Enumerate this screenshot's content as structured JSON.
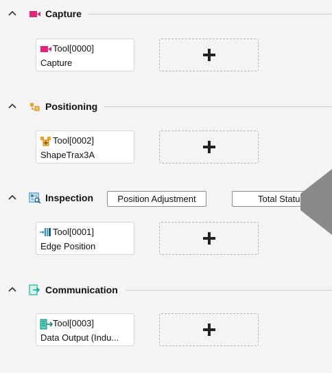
{
  "sections": [
    {
      "title": "Capture",
      "tool": {
        "id": "Tool[0000]",
        "name": "Capture",
        "icon": "camera-icon"
      }
    },
    {
      "title": "Positioning",
      "tool": {
        "id": "Tool[0002]",
        "name": "ShapeTrax3A",
        "icon": "shapetrax-icon"
      }
    },
    {
      "title": "Inspection",
      "tool": {
        "id": "Tool[0001]",
        "name": "Edge Position",
        "icon": "edge-position-icon"
      },
      "buttons": {
        "position_adjustment": "Position Adjustment",
        "total_status": "Total Status"
      }
    },
    {
      "title": "Communication",
      "tool": {
        "id": "Tool[0003]",
        "name": "Data Output (Indu...",
        "icon": "data-output-icon"
      }
    }
  ],
  "add_symbol": "+",
  "colors": {
    "capture": "#e0267a",
    "positioning": "#f0a020",
    "inspection": "#2c8ed6",
    "communication": "#1ab39a"
  }
}
